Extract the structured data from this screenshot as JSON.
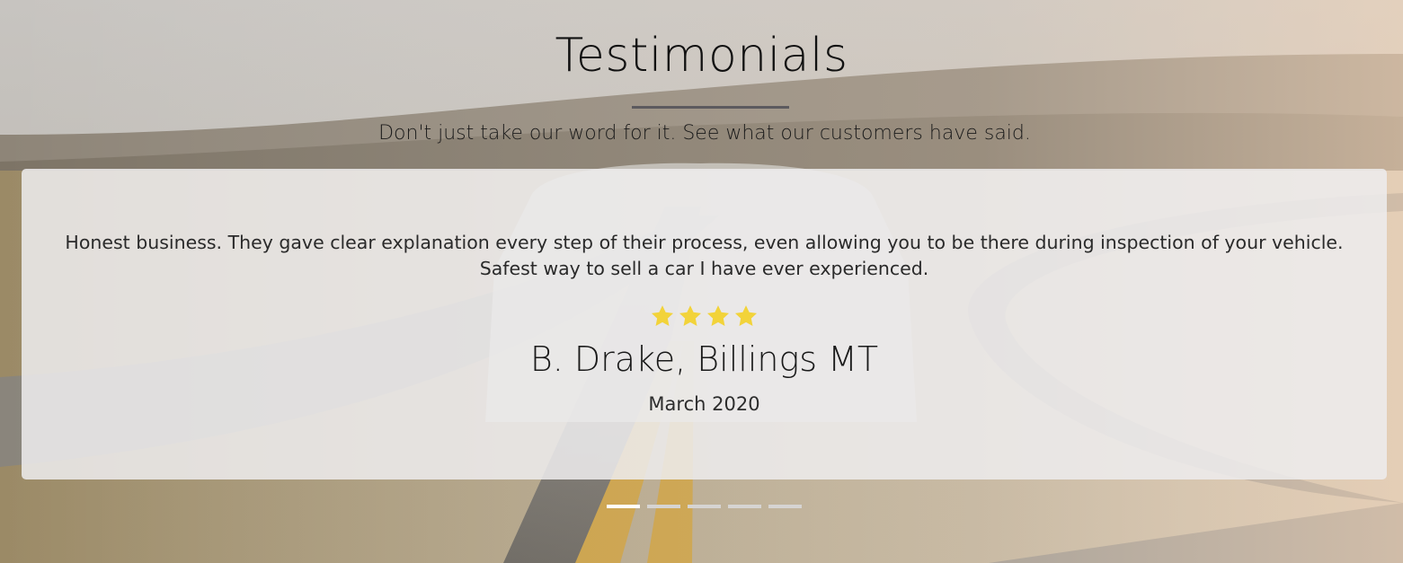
{
  "section": {
    "title": "Testimonials",
    "subtitle": "Don't just take our word for it. See what our customers have said."
  },
  "testimonial": {
    "quote": "Honest business. They gave clear explanation every step of their process, even allowing you to be there during inspection of your vehicle. Safest way to sell a car I have ever experienced.",
    "rating": 4,
    "author": "B. Drake, Billings MT",
    "date": "March 2020"
  },
  "carousel": {
    "slide_count": 5,
    "active_index": 0
  },
  "colors": {
    "star": "#f2d33a",
    "indicator_active": "#ffffff",
    "indicator_inactive": "#d6d4d2"
  },
  "icons": {
    "star": "star-icon"
  }
}
